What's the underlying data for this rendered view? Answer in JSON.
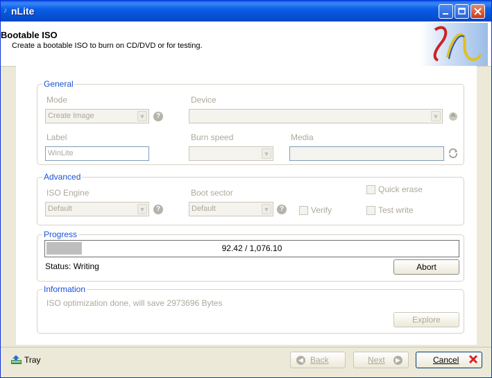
{
  "window": {
    "title": "nLite"
  },
  "header": {
    "title": "Bootable ISO",
    "subtitle": "Create a bootable ISO to burn on CD/DVD or for testing."
  },
  "general": {
    "legend": "General",
    "mode_label": "Mode",
    "mode_value": "Create Image",
    "device_label": "Device",
    "device_value": "",
    "label_label": "Label",
    "label_value": "WinLite",
    "burn_speed_label": "Burn speed",
    "burn_speed_value": "",
    "media_label": "Media",
    "media_value": ""
  },
  "advanced": {
    "legend": "Advanced",
    "iso_engine_label": "ISO Engine",
    "iso_engine_value": "Default",
    "boot_sector_label": "Boot sector",
    "boot_sector_value": "Default",
    "verify_label": "Verify",
    "quick_erase_label": "Quick erase",
    "test_write_label": "Test write"
  },
  "progress": {
    "legend": "Progress",
    "text": "92.42 / 1,076.10",
    "fraction": 0.086,
    "status": "Status: Writing",
    "abort_label": "Abort"
  },
  "information": {
    "legend": "Information",
    "text": "ISO optimization done, will save 2973696 Bytes",
    "explore_label": "Explore"
  },
  "footer": {
    "tray_label": "Tray",
    "back_label": "Back",
    "next_label": "Next",
    "cancel_label": "Cancel"
  },
  "colors": {
    "accent": "#1a4fd6",
    "titlebar": "#0553d6",
    "cancel_x": "#e02020"
  }
}
